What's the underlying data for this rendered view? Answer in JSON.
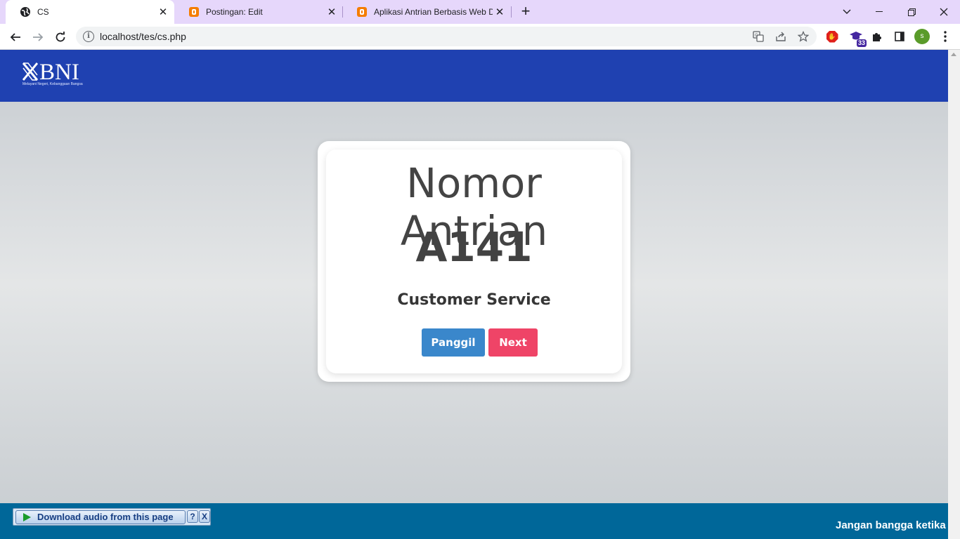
{
  "browser": {
    "tabs": [
      {
        "title": "CS",
        "active": true,
        "icon": "globe-icon"
      },
      {
        "title": "Postingan: Edit",
        "active": false,
        "icon": "blogger-icon"
      },
      {
        "title": "Aplikasi Antrian Berbasis Web De",
        "active": false,
        "icon": "blogger-icon"
      }
    ],
    "url": "localhost/tes/cs.php",
    "extension_badge": "33",
    "profile_initial": "s"
  },
  "page": {
    "logo": {
      "brand": "BNI",
      "tagline": "Melayani Negeri, Kebanggaan Bangsa"
    },
    "card": {
      "heading": "Nomor Antrian",
      "queue_number": "A141",
      "service": "Customer Service",
      "call_button": "Panggil",
      "next_button": "Next"
    },
    "footer": {
      "marquee_text": "Jangan bangga ketika",
      "download_audio_label": "Download audio from this page",
      "help_label": "?",
      "close_label": "X"
    }
  },
  "colors": {
    "navbar": "#1f41b1",
    "footer": "#006799",
    "call_button": "#3a87cb",
    "next_button": "#ef4467",
    "tabstrip": "#e6d7fb"
  }
}
